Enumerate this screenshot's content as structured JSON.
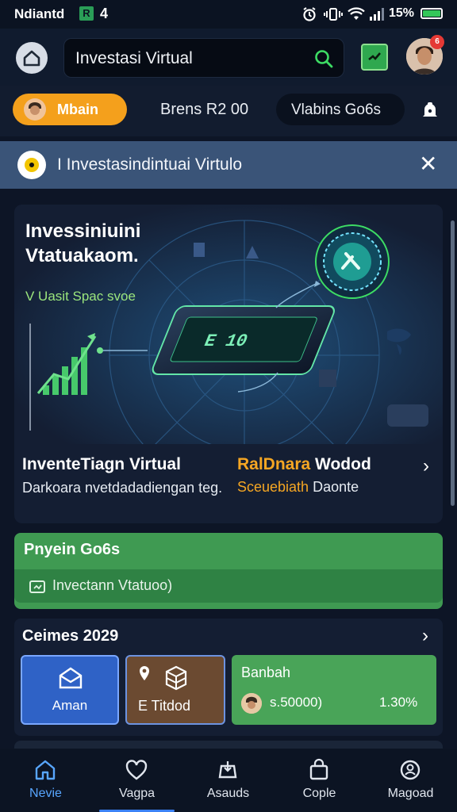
{
  "status_bar": {
    "time": "Ndiantd",
    "sim_label": "R",
    "network_label": "4",
    "battery_percent": "15%",
    "icons": [
      "alarm-icon",
      "vibrate-icon",
      "wifi-icon",
      "signal-icon",
      "battery-icon"
    ]
  },
  "header": {
    "search_value": "Investasi Virtual",
    "notification_badge": "6"
  },
  "chips": {
    "main": "Mbain",
    "second": "Brens R2 00",
    "third": "Vlabins Go6s"
  },
  "banner": {
    "text": "I Investasindintuai Virtulo"
  },
  "hero": {
    "heading": "Invessiniuini Vtatuakaom.",
    "subheading": "V Uasit Spac svoe",
    "title_left": "InventeTiagn Virtual",
    "title_right_orange": "RalDnara",
    "title_right_white": " Wodod",
    "desc_left": "Darkoara nvetdadadiengan teg.",
    "desc_right_orange": "Sceuebiath",
    "desc_right_white": " Daonte"
  },
  "promo": {
    "title": "Pnyein Go6s",
    "row_label": "Invectann Vtatuoo)"
  },
  "section": {
    "title": "Ceimes 2029",
    "tile1_label": "Aman",
    "tile2_label": "E Titdod",
    "tile3_title": "Banbah",
    "tile3_amount": "s.50000)",
    "tile3_percent": "1.30%"
  },
  "nav": {
    "items": [
      {
        "label": "Nevie",
        "icon": "home-icon"
      },
      {
        "label": "Vagpa",
        "icon": "heart-icon"
      },
      {
        "label": "Asauds",
        "icon": "assets-icon"
      },
      {
        "label": "Cople",
        "icon": "bag-icon"
      },
      {
        "label": "Magoad",
        "icon": "profile-icon"
      }
    ]
  },
  "colors": {
    "accent_orange": "#f4a01c",
    "accent_green": "#3f9a52",
    "nav_active": "#58a6ff",
    "background": "#0d1526"
  }
}
